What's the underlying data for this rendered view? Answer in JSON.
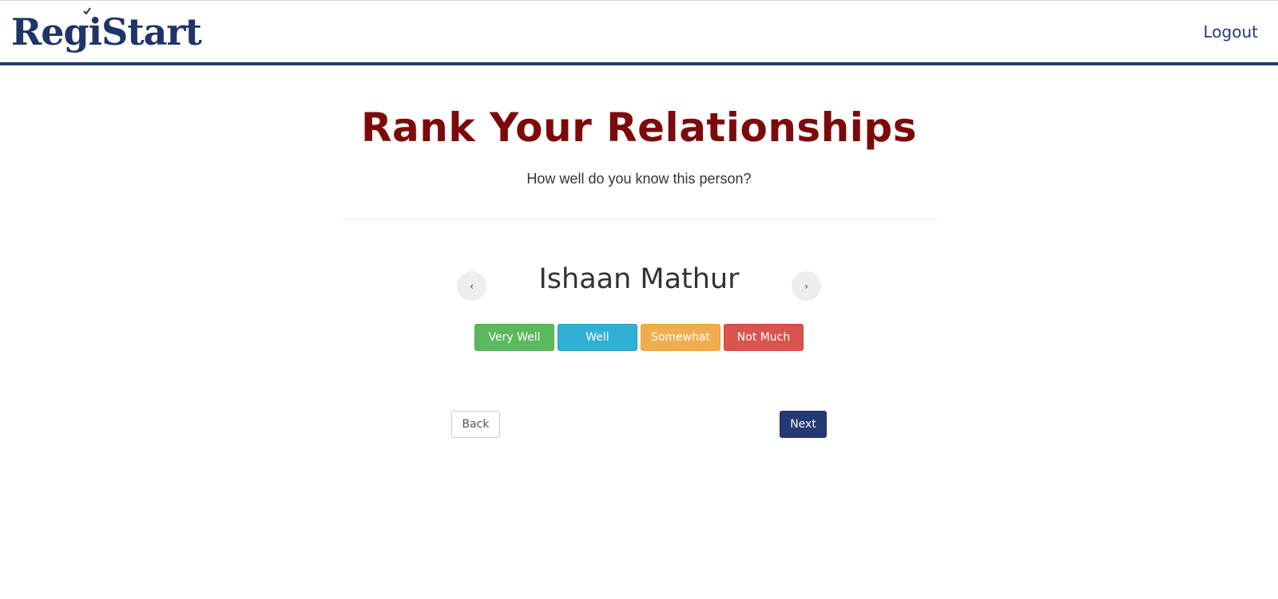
{
  "header": {
    "brand": "RegiStart",
    "logout_label": "Logout",
    "brand_color": "#1f3468"
  },
  "page": {
    "title": "Rank Your Relationships",
    "subtitle": "How well do you know this person?",
    "title_color": "#7d0a0a"
  },
  "carousel": {
    "prev_icon": "chevron-left-icon",
    "prev_glyph": "‹",
    "next_icon": "chevron-right-icon",
    "next_glyph": "›",
    "person_name": "Ishaan Mathur"
  },
  "rank_options": [
    {
      "label": "Very Well",
      "color": "#5cb85c"
    },
    {
      "label": "Well",
      "color": "#31b0d5"
    },
    {
      "label": "Somewhat",
      "color": "#f0ad4e"
    },
    {
      "label": "Not Much",
      "color": "#d9534f"
    }
  ],
  "footer_nav": {
    "back_label": "Back",
    "next_label": "Next",
    "next_color": "#243a73"
  }
}
